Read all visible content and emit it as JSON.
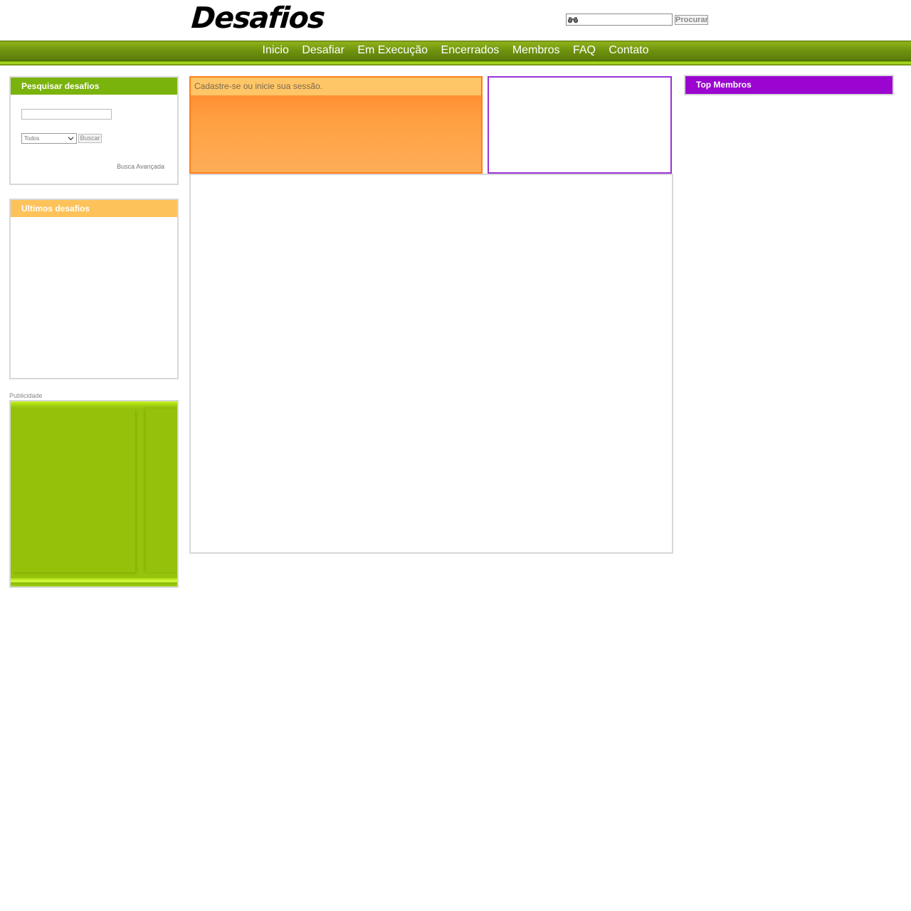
{
  "header": {
    "logo_text": "Desafios",
    "search": {
      "value": "",
      "placeholder": "",
      "button_label": "Procurar",
      "icon": "binoculars-icon"
    }
  },
  "nav": {
    "items": [
      {
        "label": "Inicio"
      },
      {
        "label": "Desafiar"
      },
      {
        "label": "Em Execução"
      },
      {
        "label": "Encerrados"
      },
      {
        "label": "Membros"
      },
      {
        "label": "FAQ"
      },
      {
        "label": "Contato"
      }
    ]
  },
  "sidebar": {
    "search_box": {
      "title": "Pesquisar desafios",
      "input_value": "",
      "select_value": "Todos",
      "button_label": "Buscar",
      "advanced_link": "Busca Avançada"
    },
    "latest": {
      "title": "Ultimos desafios"
    },
    "ad": {
      "label": "Publicidade"
    }
  },
  "main": {
    "login_message": "Cadastre-se ou inicie sua sessão."
  },
  "right": {
    "top_members": {
      "title": "Top Membros"
    }
  },
  "colors": {
    "nav_green": "#6f930f",
    "search_head_green": "#7bb30d",
    "latest_head_orange": "#fdc35a",
    "login_orange": "#ff8426",
    "purple": "#9a05d0"
  }
}
